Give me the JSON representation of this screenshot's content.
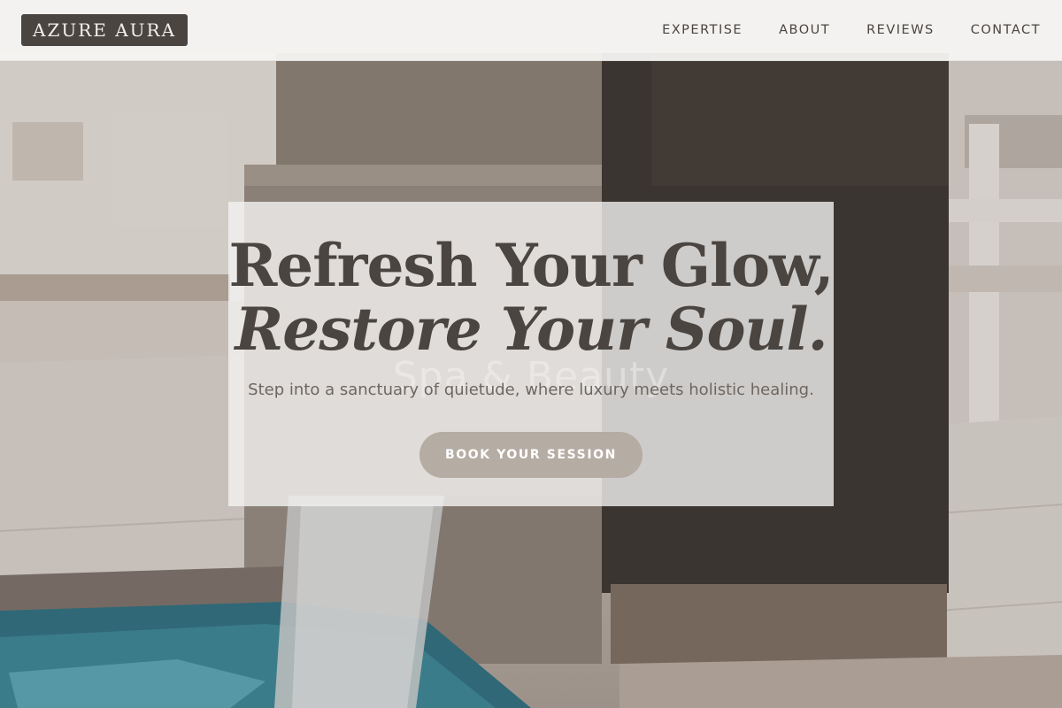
{
  "header": {
    "logo": "AZURE AURA",
    "nav": [
      "EXPERTISE",
      "ABOUT",
      "REVIEWS",
      "CONTACT"
    ]
  },
  "hero": {
    "headline_line1": "Refresh Your Glow,",
    "headline_line2": "Restore Your Soul.",
    "ghost_text": "Spa & Beauty",
    "subtitle": "Step into a sanctuary of quietude, where luxury meets holistic healing.",
    "cta_label": "BOOK YOUR SESSION"
  },
  "colors": {
    "header_bg": "#f5f4f2",
    "logo_bg": "#4a4541",
    "text_dark": "#4a4541",
    "cta_bg": "#b5aca3",
    "card_bg": "#f4f3f1"
  },
  "icons": []
}
